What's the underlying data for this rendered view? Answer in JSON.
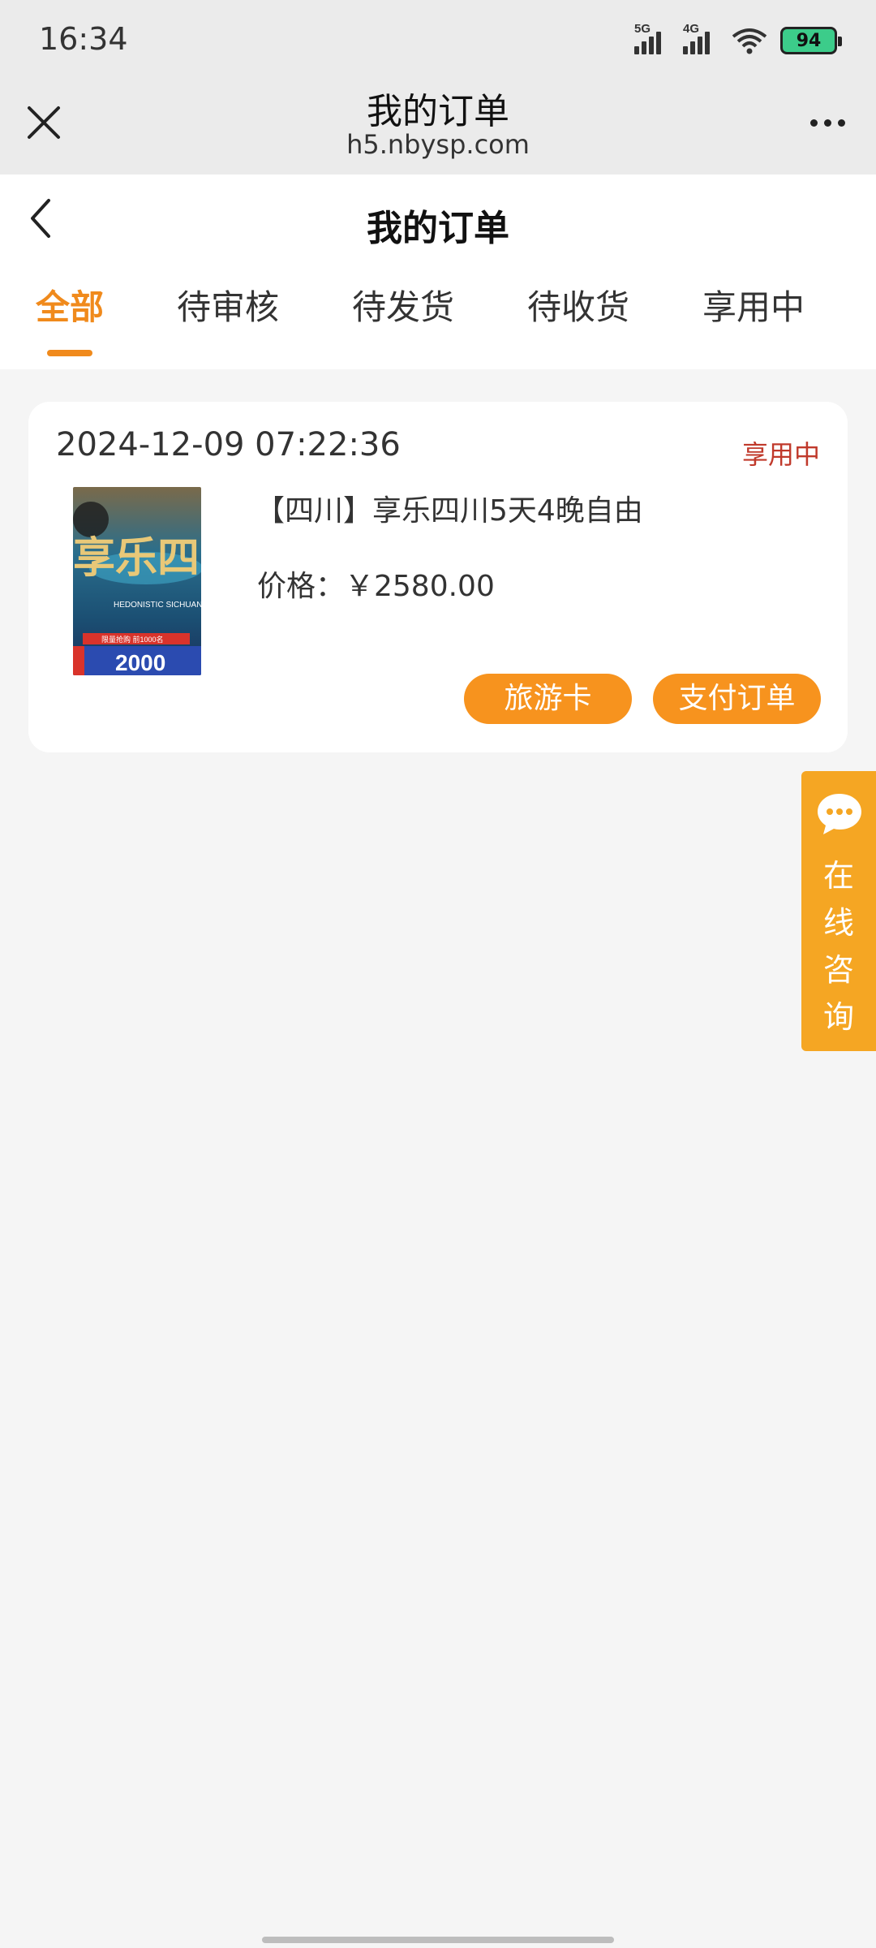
{
  "status_bar": {
    "time": "16:34",
    "signal_1_label": "5G",
    "signal_2_label": "4G",
    "battery": "94"
  },
  "browser": {
    "title": "我的订单",
    "url": "h5.nbysp.com"
  },
  "page": {
    "title": "我的订单",
    "tabs": [
      {
        "label": "全部",
        "active": true
      },
      {
        "label": "待审核",
        "active": false
      },
      {
        "label": "待发货",
        "active": false
      },
      {
        "label": "待收货",
        "active": false
      },
      {
        "label": "享用中",
        "active": false
      }
    ]
  },
  "orders": [
    {
      "date": "2024-12-09 07:22:36",
      "status": "享用中",
      "product_name": "【四川】享乐四川5天4晚自由",
      "price": "价格：￥2580.00",
      "thumb_title": "享乐四",
      "thumb_subtitle": "HEDONISTIC SICHUAN",
      "thumb_badge": "限量抢购 前1000名",
      "thumb_price": "2000",
      "buttons": {
        "travel_card": "旅游卡",
        "pay": "支付订单"
      }
    }
  ],
  "consult": {
    "label": "在线咨询",
    "chars": [
      "在",
      "线",
      "咨",
      "询"
    ]
  },
  "colors": {
    "accent": "#f08a1c",
    "button": "#f7931e",
    "status": "#c0392b",
    "consult": "#f5a623"
  }
}
